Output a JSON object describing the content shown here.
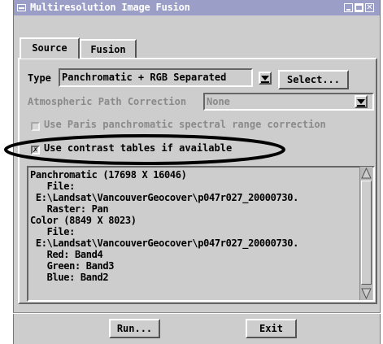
{
  "window": {
    "title": "Multiresolution Image Fusion"
  },
  "tabs": [
    {
      "label": "Source",
      "selected": true
    },
    {
      "label": "Fusion",
      "selected": false
    }
  ],
  "source": {
    "type_label": "Type",
    "type_value": "Panchromatic + RGB Separated",
    "select_button": "Select...",
    "atmos_label": "Atmospheric Path Correction",
    "atmos_value": "None",
    "paris_label": "Use Paris panchromatic spectral range correction",
    "paris_checked": false,
    "contrast_label": "Use contrast tables if available",
    "contrast_checked": true
  },
  "info_lines": [
    "Panchromatic (17698 X 16046)",
    "   File:",
    " E:\\Landsat\\VancouverGeocover\\p047r027_20000730.",
    "   Raster: Pan",
    "Color (8849 X 8023)",
    "   File:",
    " E:\\Landsat\\VancouverGeocover\\p047r027_20000730.",
    "   Red: Band4",
    "   Green: Band3",
    "   Blue: Band2"
  ],
  "buttons": {
    "run": "Run...",
    "exit": "Exit"
  },
  "colors": {
    "titlebar": "#9b9fc7",
    "window_bg": "#cdcdcd",
    "highlight_ellipse": "#000000"
  }
}
